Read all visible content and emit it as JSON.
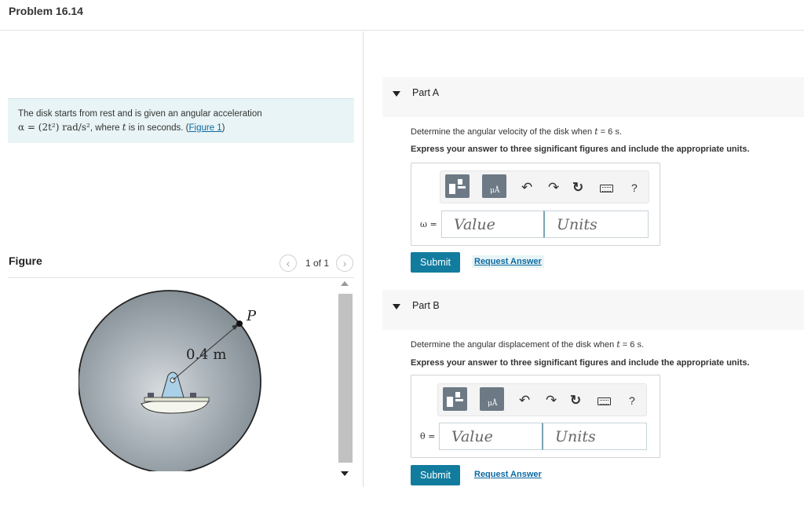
{
  "header": {
    "title": "Problem 16.14"
  },
  "problem": {
    "line1": "The disk starts from rest and is given an angular acceleration",
    "alpha_expr": "α = (2t²) rad/s²",
    "mid_text": ", where ",
    "t_var": "t",
    "tail_text": " is in seconds. (",
    "figure_link": "Figure 1",
    "close_paren": ")"
  },
  "figure": {
    "label": "Figure",
    "counter": "1 of 1",
    "prev_symbol": "‹",
    "next_symbol": "›",
    "radius_label": "0.4 m",
    "point_label": "P"
  },
  "part_a": {
    "label": "Part A",
    "question_prefix": "Determine the angular velocity of the disk when ",
    "t_var": "t",
    "question_suffix": " = 6 ",
    "unit": "s",
    "question_end": ".",
    "instruction": "Express your answer to three significant figures and include the appropriate units.",
    "var_label": "ω =",
    "value_placeholder": "Value",
    "units_placeholder": "Units",
    "submit_label": "Submit",
    "request_label": "Request Answer"
  },
  "part_b": {
    "label": "Part B",
    "question_prefix": "Determine the angular displacement of the disk when ",
    "t_var": "t",
    "question_suffix": " = 6 ",
    "unit": "s",
    "question_end": ".",
    "instruction": "Express your answer to three significant figures and include the appropriate units.",
    "var_label": "θ =",
    "value_placeholder": "Value",
    "units_placeholder": "Units",
    "submit_label": "Submit",
    "request_label": "Request Answer"
  },
  "toolbar": {
    "undo_symbol": "↶",
    "redo_symbol": "↷",
    "reset_symbol": "↻",
    "help_symbol": "?"
  },
  "colors": {
    "accent": "#127c9e",
    "link": "#0b6aa2",
    "problem_bg": "#e8f4f5",
    "disk": "#9aa5ad"
  },
  "icons": [
    "template-icon",
    "symbol-template-icon",
    "undo-icon",
    "redo-icon",
    "reset-icon",
    "keyboard-icon",
    "help-icon",
    "collapse-triangle-icon"
  ]
}
